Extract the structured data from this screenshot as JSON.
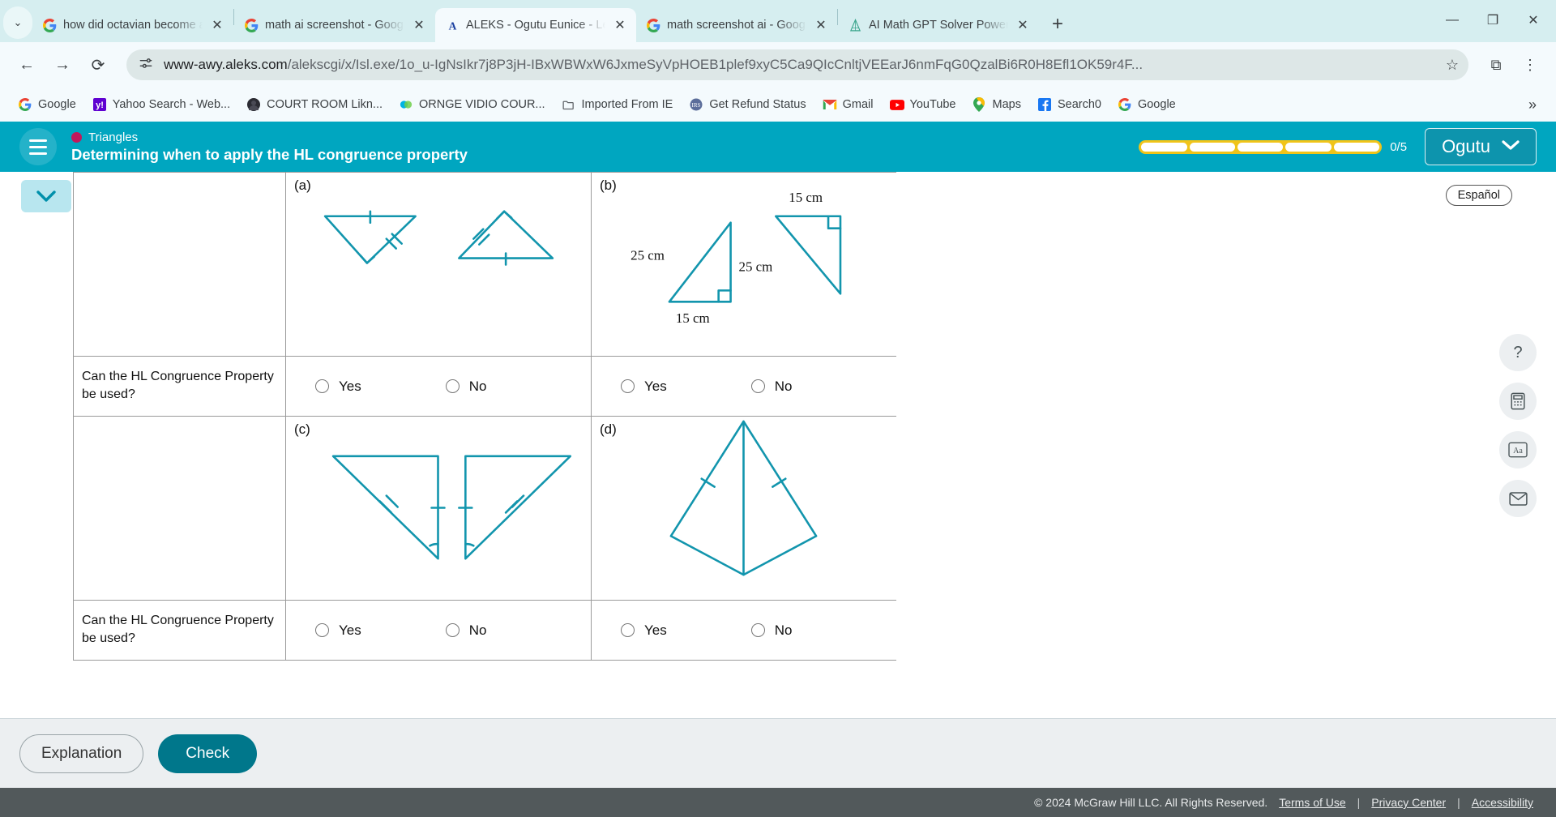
{
  "browser": {
    "tabs": [
      {
        "title": "how did octavian become a",
        "favicon": "google-icon",
        "active": false
      },
      {
        "title": "math ai screenshot - Goog",
        "favicon": "google-icon",
        "active": false
      },
      {
        "title": "ALEKS - Ogutu Eunice - Lea",
        "favicon": "aleks-icon",
        "active": true
      },
      {
        "title": "math screenshot ai - Goog",
        "favicon": "google-icon",
        "active": false
      },
      {
        "title": "AI Math GPT Solver Power",
        "favicon": "mathgpt-icon",
        "active": false
      }
    ],
    "new_tab_label": "+",
    "window_controls": {
      "minimize": "—",
      "restore": "❐",
      "close": "✕"
    },
    "tabstrip_chevron": "⌄",
    "nav": {
      "back": "←",
      "forward": "→",
      "reload": "⟳"
    },
    "url": {
      "domain": "www-awy.aleks.com",
      "path": "/alekscgi/x/Isl.exe/1o_u-IgNsIkr7j8P3jH-IBxWBWxW6JxmeSyVpHOEB1plef9xyC5Ca9QIcCnltjVEEarJ6nmFqG0QzalBi6R0H8Efl1OK59r4F..."
    },
    "star_icon": "☆",
    "extensions_icon": "⧉",
    "menu_icon": "⋮",
    "bookmarks": [
      {
        "label": "Google",
        "icon": "google-icon"
      },
      {
        "label": "Yahoo Search - Web...",
        "icon": "yahoo-icon"
      },
      {
        "label": "COURT ROOM Likn...",
        "icon": "avatar-icon"
      },
      {
        "label": "ORNGE VIDIO COUR...",
        "icon": "orange-icon"
      },
      {
        "label": "Imported From IE",
        "icon": "folder-icon"
      },
      {
        "label": "Get Refund Status",
        "icon": "irs-icon"
      },
      {
        "label": "Gmail",
        "icon": "gmail-icon"
      },
      {
        "label": "YouTube",
        "icon": "youtube-icon"
      },
      {
        "label": "Maps",
        "icon": "maps-icon"
      },
      {
        "label": "Search0",
        "icon": "facebook-icon"
      },
      {
        "label": "Google",
        "icon": "google-icon"
      }
    ],
    "bookmarks_overflow": "»"
  },
  "aleks": {
    "topic": "Triangles",
    "title": "Determining when to apply the HL congruence property",
    "progress": {
      "segments": 5,
      "filled": 0,
      "label": "0/5"
    },
    "user_button": "Ogutu",
    "user_caret": "⌄",
    "collapse_caret": "⌄",
    "espanol": "Español",
    "tools": [
      {
        "name": "help-icon",
        "glyph": "?"
      },
      {
        "name": "calculator-icon",
        "glyph": "▤"
      },
      {
        "name": "font-size-icon",
        "glyph": "Aa"
      },
      {
        "name": "mail-icon",
        "glyph": "✉"
      }
    ]
  },
  "worksheet": {
    "question_label": "Can the HL Congruence Property be used?",
    "options": {
      "yes": "Yes",
      "no": "No"
    },
    "figures": [
      {
        "id": "a",
        "letter": "(a)",
        "labels": []
      },
      {
        "id": "b",
        "letter": "(b)",
        "labels": [
          "25 cm",
          "15 cm",
          "15 cm",
          "25 cm"
        ]
      },
      {
        "id": "c",
        "letter": "(c)",
        "labels": []
      },
      {
        "id": "d",
        "letter": "(d)",
        "labels": []
      }
    ],
    "figure_color": "#1295ad"
  },
  "actions": {
    "explanation": "Explanation",
    "check": "Check"
  },
  "footer": {
    "copyright": "© 2024 McGraw Hill LLC. All Rights Reserved.",
    "links": [
      "Terms of Use",
      "Privacy Center",
      "Accessibility"
    ],
    "separator": "|"
  }
}
